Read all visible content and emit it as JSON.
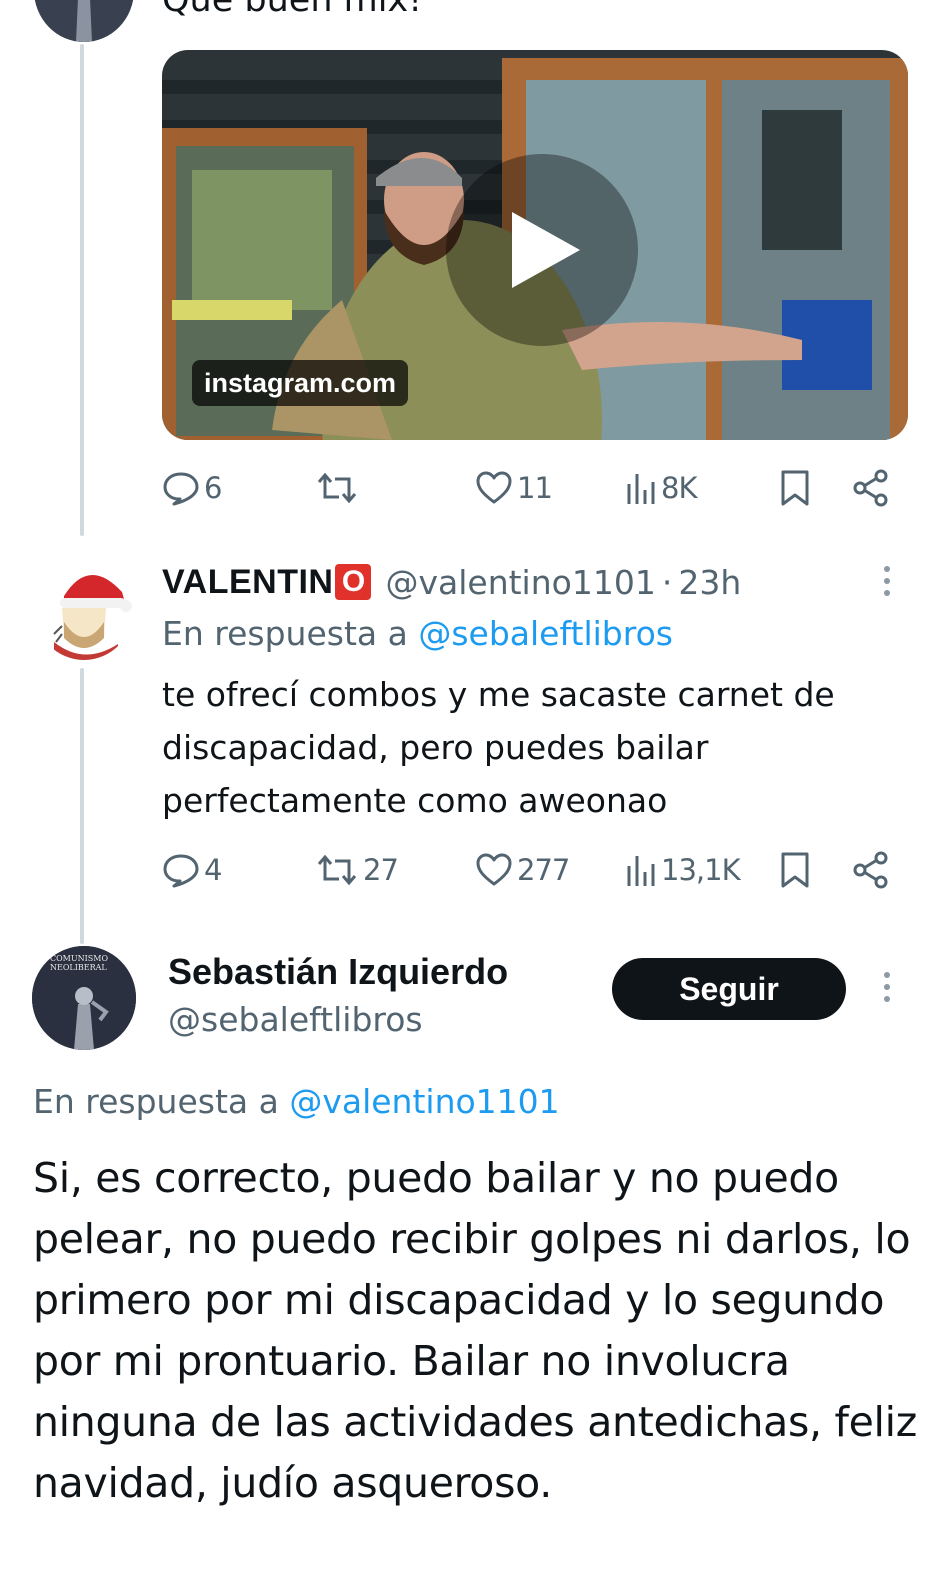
{
  "tweet1": {
    "text": "Qué buen mix!",
    "card_domain": "instagram.com",
    "actions": {
      "replies": "6",
      "retweets": "",
      "likes": "11",
      "views": "8K"
    }
  },
  "tweet2": {
    "name": "VALENTIN",
    "name_badge": "O",
    "handle": "@valentino1101",
    "separator": "·",
    "time": "23h",
    "reply_prefix": "En respuesta a",
    "reply_handle": "@sebaleftlibros",
    "text": "te ofrecí combos y me sacaste carnet de discapacidad, pero puedes bailar perfectamente como aweonao",
    "actions": {
      "replies": "4",
      "retweets": "27",
      "likes": "277",
      "views": "13,1K"
    }
  },
  "tweet3": {
    "name": "Sebastián Izquierdo",
    "handle": "@sebaleftlibros",
    "follow_label": "Seguir",
    "avatar_text": "COMUNISMO NEOLIBERAL",
    "reply_prefix": "En respuesta a",
    "reply_handle": "@valentino1101",
    "text": "Si, es correcto, puedo bailar y no puedo pelear, no puedo recibir golpes ni darlos, lo primero por mi discapacidad y lo segundo por mi prontuario. Bailar no involucra ninguna de las actividades antedichas, feliz navidad, judío asqueroso."
  },
  "colors": {
    "link": "#1d9bf0",
    "secondary": "#536471",
    "follow_button": "#0f1419",
    "thread_line": "#cfd9de",
    "badge_red": "#e0322b"
  },
  "icons": [
    "reply-icon",
    "retweet-icon",
    "like-icon",
    "views-icon",
    "bookmark-icon",
    "share-icon",
    "more-icon",
    "play-icon"
  ]
}
